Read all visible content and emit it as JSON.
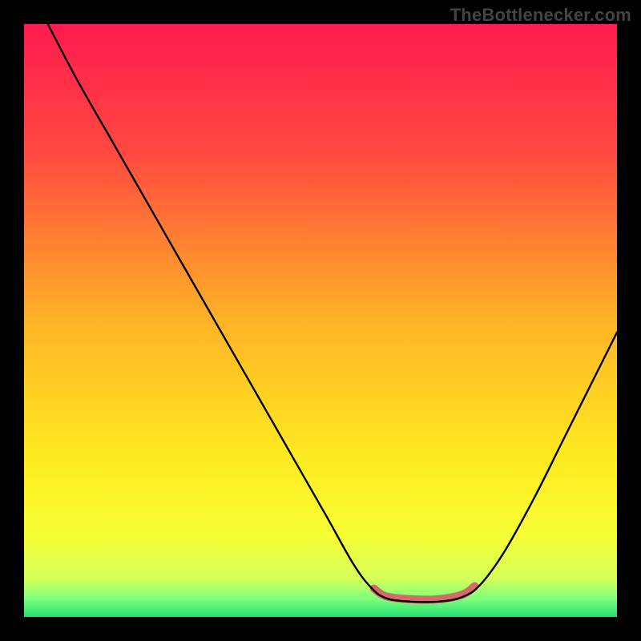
{
  "watermark": "TheBottlenecker.com",
  "chart_data": {
    "type": "line",
    "title": "",
    "xlabel": "",
    "ylabel": "",
    "xlim": [
      0,
      1
    ],
    "ylim": [
      0,
      1
    ],
    "grid": false,
    "legend": false,
    "background_gradient": {
      "stops": [
        {
          "offset": 0.0,
          "color": "#ff1b50"
        },
        {
          "offset": 0.22,
          "color": "#ff4a3f"
        },
        {
          "offset": 0.5,
          "color": "#ffb327"
        },
        {
          "offset": 0.72,
          "color": "#ffe81f"
        },
        {
          "offset": 0.86,
          "color": "#f6ff33"
        },
        {
          "offset": 0.935,
          "color": "#d6ff5a"
        },
        {
          "offset": 0.97,
          "color": "#7dff7d"
        },
        {
          "offset": 1.0,
          "color": "#22e06e"
        }
      ]
    },
    "series": [
      {
        "name": "bottleneck-curve",
        "color": "#000000",
        "width": 2.4,
        "points": [
          {
            "x": 0.04,
            "y": 1.0
          },
          {
            "x": 0.09,
            "y": 0.905
          },
          {
            "x": 0.15,
            "y": 0.8
          },
          {
            "x": 0.21,
            "y": 0.695
          },
          {
            "x": 0.27,
            "y": 0.59
          },
          {
            "x": 0.33,
            "y": 0.485
          },
          {
            "x": 0.39,
            "y": 0.38
          },
          {
            "x": 0.45,
            "y": 0.275
          },
          {
            "x": 0.51,
            "y": 0.17
          },
          {
            "x": 0.555,
            "y": 0.09
          },
          {
            "x": 0.585,
            "y": 0.05
          },
          {
            "x": 0.61,
            "y": 0.032
          },
          {
            "x": 0.65,
            "y": 0.026
          },
          {
            "x": 0.7,
            "y": 0.026
          },
          {
            "x": 0.74,
            "y": 0.034
          },
          {
            "x": 0.77,
            "y": 0.055
          },
          {
            "x": 0.81,
            "y": 0.11
          },
          {
            "x": 0.86,
            "y": 0.2
          },
          {
            "x": 0.91,
            "y": 0.3
          },
          {
            "x": 0.96,
            "y": 0.4
          },
          {
            "x": 1.0,
            "y": 0.48
          }
        ]
      },
      {
        "name": "highlight-band",
        "color": "#d46a6a",
        "width": 10,
        "points": [
          {
            "x": 0.59,
            "y": 0.048
          },
          {
            "x": 0.61,
            "y": 0.035
          },
          {
            "x": 0.65,
            "y": 0.03
          },
          {
            "x": 0.7,
            "y": 0.03
          },
          {
            "x": 0.74,
            "y": 0.038
          },
          {
            "x": 0.76,
            "y": 0.052
          }
        ]
      }
    ]
  }
}
